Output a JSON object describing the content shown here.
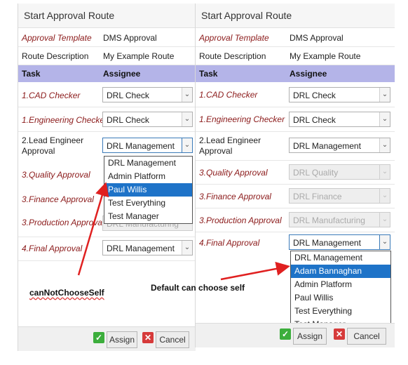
{
  "left": {
    "title": "Start Approval Route",
    "template_label": "Approval Template",
    "template_value": "DMS Approval",
    "route_label": "Route Description",
    "route_value": "My Example Route",
    "col_task": "Task",
    "col_assignee": "Assignee",
    "tasks": [
      {
        "label": "1.CAD Checker",
        "assignee": "DRL Check"
      },
      {
        "label": "1.Engineering Checker",
        "assignee": "DRL Check"
      },
      {
        "label_line1": "2.Lead Engineer",
        "label_line2": "Approval",
        "assignee": "DRL Management"
      },
      {
        "label": "3.Quality Approval"
      },
      {
        "label": "3.Finance Approval"
      },
      {
        "label": "3.Production Approva",
        "assignee": "DRL Manufacturing"
      },
      {
        "label": "4.Final Approval",
        "assignee": "DRL Management"
      }
    ],
    "dropdown_options": [
      "DRL Management",
      "Admin Platform",
      "Paul Willis",
      "Test Everything",
      "Test Manager"
    ],
    "dropdown_selected": "Paul Willis",
    "assign_label": "Assign",
    "cancel_label": "Cancel"
  },
  "right": {
    "title": "Start Approval Route",
    "template_label": "Approval Template",
    "template_value": "DMS Approval",
    "route_label": "Route Description",
    "route_value": "My Example Route",
    "col_task": "Task",
    "col_assignee": "Assignee",
    "tasks": [
      {
        "label": "1.CAD Checker",
        "assignee": "DRL Check"
      },
      {
        "label": "1.Engineering Checker",
        "assignee": "DRL Check"
      },
      {
        "label_line1": "2.Lead Engineer",
        "label_line2": "Approval",
        "assignee": "DRL Management"
      },
      {
        "label": "3.Quality Approval",
        "assignee": "DRL Quality"
      },
      {
        "label": "3.Finance Approval",
        "assignee": "DRL Finance"
      },
      {
        "label": "3.Production Approval",
        "assignee": "DRL Manufacturing"
      },
      {
        "label": "4.Final Approval",
        "assignee": "DRL Management"
      }
    ],
    "dropdown_options": [
      "DRL Management",
      "Adam Bannaghan",
      "Admin Platform",
      "Paul Willis",
      "Test Everything",
      "Test Manager"
    ],
    "dropdown_selected": "Adam Bannaghan",
    "assign_label": "Assign",
    "cancel_label": "Cancel"
  },
  "annotations": {
    "left": "canNotChooseSelf",
    "right": "Default can choose self"
  },
  "colors": {
    "header_band": "#b4b4e8",
    "task_label": "#8b1a1a",
    "selected_option": "#1e73c8",
    "annotation_arrow": "#e02020"
  },
  "icons": {
    "assign": "check-icon",
    "cancel": "x-icon",
    "select": "chevron-down-icon"
  }
}
